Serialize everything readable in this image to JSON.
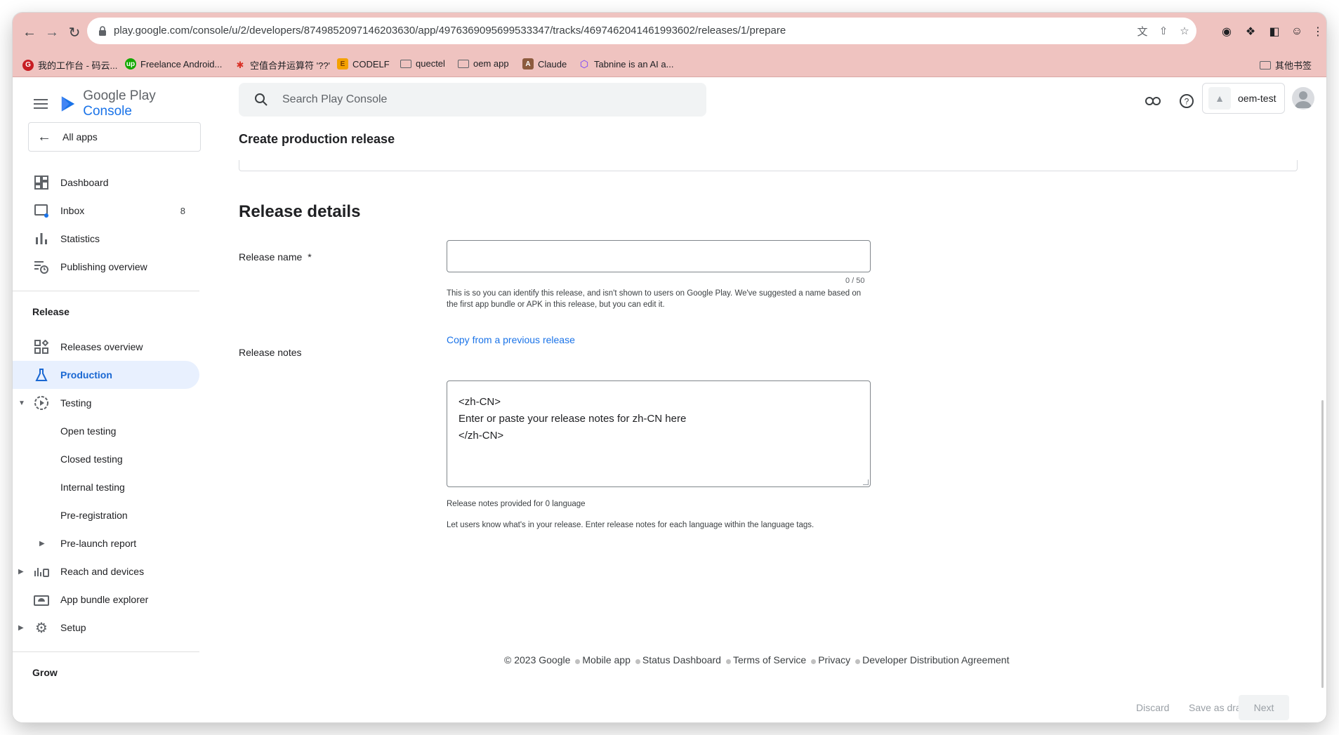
{
  "browser": {
    "url": "play.google.com/console/u/2/developers/8749852097146203630/app/4976369095699533347/tracks/4697462041461993602/releases/1/prepare",
    "bookmarks": [
      {
        "label": "我的工作台 - 码云...",
        "icon": "gitee-icon",
        "color": "#c71d23"
      },
      {
        "label": "Freelance Android...",
        "icon": "upwork-icon",
        "color": "#14a800"
      },
      {
        "label": "空值合并运算符 '??'",
        "icon": "mdn-icon",
        "color": "#d93025"
      },
      {
        "label": "CODELF",
        "icon": "codelf-icon",
        "color": "#f4a100"
      },
      {
        "label": "quectel",
        "icon": "folder-icon"
      },
      {
        "label": "oem app",
        "icon": "folder-icon"
      },
      {
        "label": "Claude",
        "icon": "claude-icon",
        "color": "#8c5b3e"
      },
      {
        "label": "Tabnine is an AI a...",
        "icon": "tabnine-icon",
        "color": "#6b37ff"
      }
    ],
    "other_bookmarks": "其他书签"
  },
  "logo": {
    "google_play": "Google Play",
    "console": "Console"
  },
  "sidebar": {
    "all_apps": "All apps",
    "top_items": [
      {
        "label": "Dashboard",
        "icon": "dashboard-icon"
      },
      {
        "label": "Inbox",
        "icon": "inbox-icon",
        "count": "8"
      },
      {
        "label": "Statistics",
        "icon": "statistics-icon"
      },
      {
        "label": "Publishing overview",
        "icon": "publishing-overview-icon"
      }
    ],
    "release_section": "Release",
    "release_items": [
      {
        "label": "Releases overview",
        "icon": "releases-overview-icon"
      },
      {
        "label": "Production",
        "icon": "production-icon",
        "active": true
      },
      {
        "label": "Testing",
        "icon": "testing-icon",
        "expanded": true
      },
      {
        "label": "Open testing"
      },
      {
        "label": "Closed testing"
      },
      {
        "label": "Internal testing"
      },
      {
        "label": "Pre-registration"
      },
      {
        "label": "Pre-launch report",
        "collapsible": true
      },
      {
        "label": "Reach and devices",
        "icon": "reach-devices-icon",
        "collapsible": true
      },
      {
        "label": "App bundle explorer",
        "icon": "app-bundle-icon"
      },
      {
        "label": "Setup",
        "icon": "setup-gear-icon",
        "collapsible": true
      }
    ],
    "grow_section": "Grow"
  },
  "header": {
    "search_placeholder": "Search Play Console",
    "account_name": "oem-test"
  },
  "page": {
    "title": "Create production release",
    "section_title": "Release details",
    "release_name_label": "Release name",
    "required_marker": "*",
    "release_name_value": "",
    "char_count": "0 / 50",
    "release_name_helper": "This is so you can identify this release, and isn't shown to users on Google Play. We've suggested a name based on the first app bundle or APK in this release, but you can edit it.",
    "release_notes_label": "Release notes",
    "copy_link": "Copy from a previous release",
    "release_notes_lines": [
      "<zh-CN>",
      "Enter or paste your release notes for zh-CN here",
      "</zh-CN>"
    ],
    "notes_count": "Release notes provided for 0 language",
    "notes_helper": "Let users know what's in your release. Enter release notes for each language within the language tags."
  },
  "footer": {
    "copyright": "© 2023 Google",
    "links": [
      "Mobile app",
      "Status Dashboard",
      "Terms of Service",
      "Privacy",
      "Developer Distribution Agreement"
    ]
  },
  "actions": {
    "discard": "Discard",
    "save_draft": "Save as draft",
    "next": "Next"
  },
  "colors": {
    "accent": "#1a73e8",
    "active_bg": "#e8f0fe",
    "chrome": "#efc3c0"
  }
}
